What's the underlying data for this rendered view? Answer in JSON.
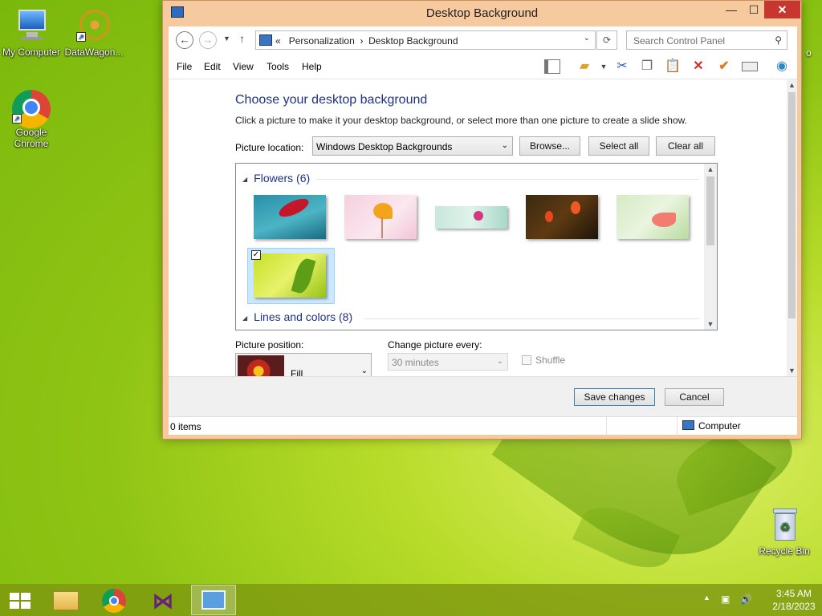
{
  "desktop": {
    "icons": [
      {
        "label": "My Computer"
      },
      {
        "label": "DataWagon..."
      },
      {
        "label": "Google Chrome"
      },
      {
        "label": "Recycle Bin"
      }
    ],
    "partial_edge_text": "o"
  },
  "window": {
    "title": "Desktop Background",
    "controls": {
      "minimize": "—",
      "maximize": "☐",
      "close": "✕"
    }
  },
  "address": {
    "crumbs": [
      "«",
      "Personalization",
      "›",
      "Desktop Background"
    ],
    "search_placeholder": "Search Control Panel"
  },
  "menu": [
    "File",
    "Edit",
    "View",
    "Tools",
    "Help"
  ],
  "content": {
    "heading": "Choose your desktop background",
    "description": "Click a picture to make it your desktop background, or select more than one picture to create a slide show.",
    "picture_location_label": "Picture location:",
    "picture_location_value": "Windows Desktop Backgrounds",
    "browse_label": "Browse...",
    "select_all_label": "Select all",
    "clear_all_label": "Clear all",
    "groups": [
      {
        "title": "Flowers (6)"
      },
      {
        "title": "Lines and colors (8)"
      }
    ],
    "picture_position_label": "Picture position:",
    "picture_position_value": "Fill",
    "change_every_label": "Change picture every:",
    "change_every_value": "30 minutes",
    "shuffle_label": "Shuffle"
  },
  "footer": {
    "save_label": "Save changes",
    "cancel_label": "Cancel"
  },
  "status": {
    "items": "0 items",
    "location": "Computer"
  },
  "taskbar": {
    "time": "3:45 AM",
    "date": "2/18/2023"
  },
  "colors": {
    "accent_heading": "#1e3287",
    "window_frame": "#f7c99e",
    "close_button": "#c7372f"
  }
}
